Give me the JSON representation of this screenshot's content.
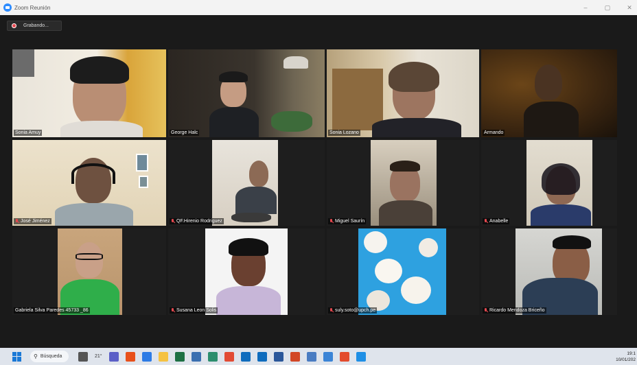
{
  "window": {
    "title": "Zoom Reunión",
    "minimize": "–",
    "maximize": "▢",
    "close": "✕"
  },
  "recording": {
    "label": "Grabando..."
  },
  "participants": [
    {
      "name": "Sonia Amuy",
      "muted": false,
      "active": false
    },
    {
      "name": "George Halc",
      "muted": false,
      "active": true
    },
    {
      "name": "Sonia Lozano",
      "muted": false,
      "active": false
    },
    {
      "name": "Armando",
      "muted": false,
      "active": false
    },
    {
      "name": "José Jiménez",
      "muted": true,
      "active": false
    },
    {
      "name": "QF.Hirenio Rodriguez",
      "muted": true,
      "active": false
    },
    {
      "name": "Miguel Saurín",
      "muted": true,
      "active": false
    },
    {
      "name": "Anabelle",
      "muted": true,
      "active": false
    },
    {
      "name": "Gabriela Silva Paredes 45733 _86",
      "muted": false,
      "active": false
    },
    {
      "name": "Susana Leon Solis",
      "muted": true,
      "active": false
    },
    {
      "name": "suly.soto@upch.pe",
      "muted": true,
      "active": false
    },
    {
      "name": "Ricardo Mendoza Briceño",
      "muted": true,
      "active": false
    }
  ],
  "taskbar": {
    "search_label": "Búsqueda",
    "weather": "21°",
    "time": "19:1",
    "date": "10/01/202",
    "icons": [
      "windows-start-icon",
      "search-icon",
      "task-view-icon",
      "weather-icon",
      "teams-icon",
      "office-icon",
      "notes-icon",
      "file-explorer-icon",
      "excel-icon",
      "photos-icon",
      "edge-icon",
      "chrome-icon",
      "outlook-icon",
      "mail-icon",
      "word-icon",
      "powerpoint-icon",
      "notepad-icon",
      "calendar-icon",
      "app-icon",
      "help-icon"
    ],
    "icon_colors": [
      "#1a78d6",
      "#333333",
      "#555555",
      "#f5a623",
      "#5b5fc7",
      "#e8501b",
      "#2d7be5",
      "#f5c242",
      "#1d7044",
      "#3a6fb0",
      "#2c8e6e",
      "#e24b35",
      "#0f6cbd",
      "#0f6cbd",
      "#2b579a",
      "#d24726",
      "#4a7cc2",
      "#3b84d6",
      "#e34b2d",
      "#1f8fe5"
    ]
  }
}
